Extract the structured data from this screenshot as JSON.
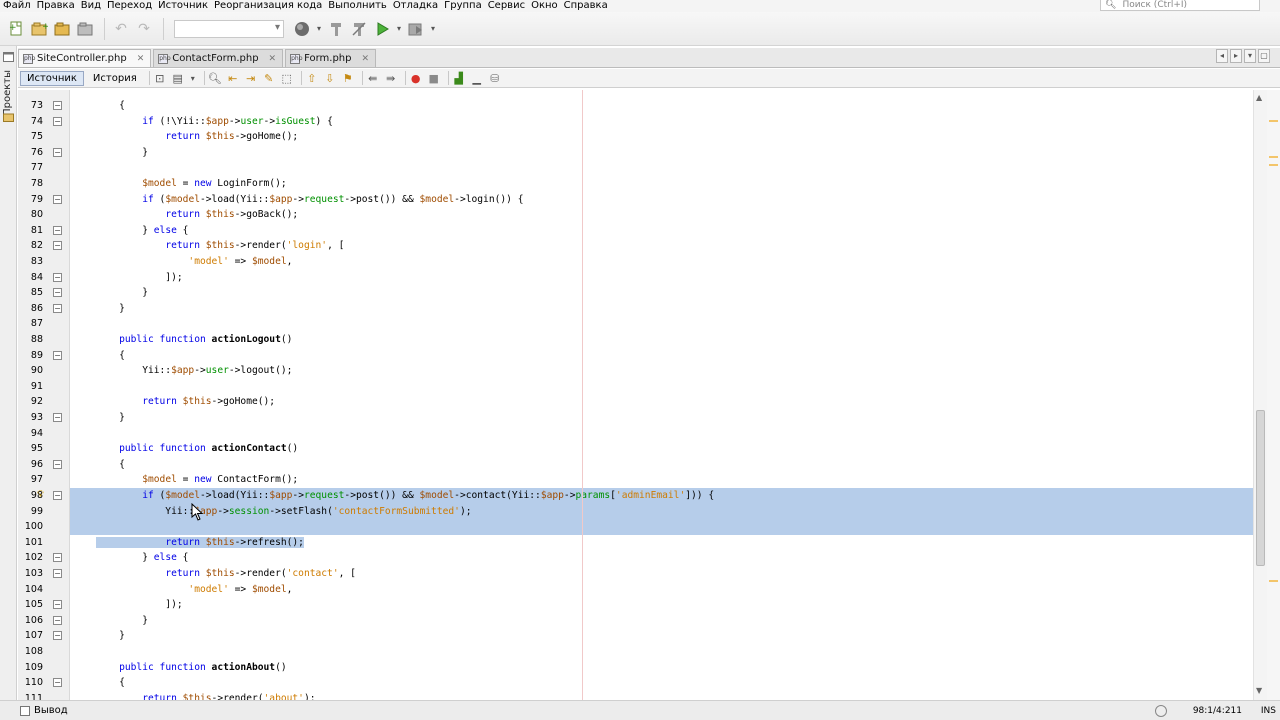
{
  "menubar": {
    "items": [
      "Файл",
      "Правка",
      "Вид",
      "Переход",
      "Источник",
      "Реорганизация кода",
      "Выполнить",
      "Отладка",
      "Группа",
      "Сервис",
      "Окно",
      "Справка"
    ],
    "search_placeholder": "Поиск (Ctrl+I)"
  },
  "toolbar": {
    "icons": [
      "new-file-icon",
      "new-project-icon",
      "open-project-icon",
      "close-project-icon",
      "undo-icon",
      "redo-icon",
      "config-select",
      "browser-icon",
      "build-icon",
      "clean-build-icon",
      "run-icon",
      "debug-icon"
    ]
  },
  "left_strip": {
    "label": "Проекты"
  },
  "tabs": [
    {
      "label": "SiteController.php",
      "active": true
    },
    {
      "label": "ContactForm.php",
      "active": false
    },
    {
      "label": "Form.php",
      "active": false
    }
  ],
  "editor_toolbar": {
    "source_label": "Источник",
    "history_label": "История"
  },
  "code": {
    "selection_color": "#b6cdea",
    "lines": [
      {
        "n": "73",
        "fold": "-"
      },
      {
        "n": "74",
        "fold": "-"
      },
      {
        "n": "75"
      },
      {
        "n": "76",
        "fold": "-"
      },
      {
        "n": "77"
      },
      {
        "n": "78"
      },
      {
        "n": "79",
        "fold": "-"
      },
      {
        "n": "80"
      },
      {
        "n": "81",
        "fold": "-"
      },
      {
        "n": "82",
        "fold": "-"
      },
      {
        "n": "83"
      },
      {
        "n": "84",
        "fold": "-"
      },
      {
        "n": "85",
        "fold": "-"
      },
      {
        "n": "86",
        "fold": "-"
      },
      {
        "n": "87"
      },
      {
        "n": "88"
      },
      {
        "n": "89",
        "fold": "-"
      },
      {
        "n": "90"
      },
      {
        "n": "91"
      },
      {
        "n": "92"
      },
      {
        "n": "93",
        "fold": "-"
      },
      {
        "n": "94"
      },
      {
        "n": "95"
      },
      {
        "n": "96",
        "fold": "-"
      },
      {
        "n": "97"
      },
      {
        "n": "98",
        "fold": "-",
        "bulb": true
      },
      {
        "n": "99"
      },
      {
        "n": "100"
      },
      {
        "n": "101"
      },
      {
        "n": "102",
        "fold": "-"
      },
      {
        "n": "103",
        "fold": "-"
      },
      {
        "n": "104"
      },
      {
        "n": "105",
        "fold": "-"
      },
      {
        "n": "106",
        "fold": "-"
      },
      {
        "n": "107",
        "fold": "-"
      },
      {
        "n": "108"
      },
      {
        "n": "109"
      },
      {
        "n": "110",
        "fold": "-"
      },
      {
        "n": "111"
      }
    ]
  },
  "status": {
    "output_label": "Вывод",
    "position": "98:1/4:211",
    "mode": "INS"
  }
}
